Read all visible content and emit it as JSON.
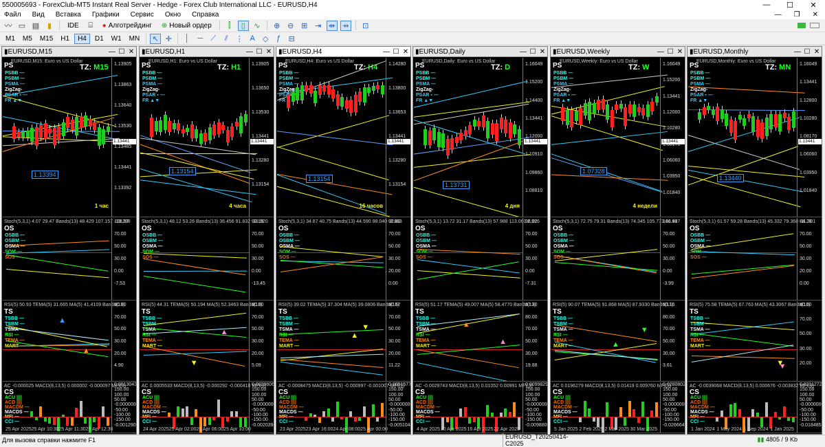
{
  "window": {
    "title": "550005693 - ForexClub-MT5 Instant Real Server - Hedge - Forex Club International LLC - EURUSD,H4",
    "min_icon": "minimize-icon",
    "max_icon": "maximize-icon",
    "close_icon": "close-icon"
  },
  "menu": {
    "items": [
      "Файл",
      "Вид",
      "Вставка",
      "Графики",
      "Сервис",
      "Окно",
      "Справка"
    ]
  },
  "toolbar": {
    "ide": "IDE",
    "algo": "Алготрейдинг",
    "new_order": "Новый ордер"
  },
  "timeframes": {
    "items": [
      "M1",
      "M5",
      "M15",
      "H1",
      "H4",
      "D1",
      "W1",
      "MN"
    ],
    "active": "H4"
  },
  "charts": [
    {
      "tab": "EURUSD,M15",
      "desc": "EURUSD,M15: Euro vs US Dollar",
      "tz": "M15",
      "period": "1 час",
      "prices": [
        "1.13905",
        "1.13863",
        "1.13640",
        "1.13530",
        "1.13485",
        "1.13441",
        "1.13392"
      ],
      "box": "1.13394",
      "os_hdr": "Stoch(5,3,1) 4.07 29.47 Bands(13) 48.429 107.157 -10.298",
      "os_axis": [
        "108.97",
        "70.00",
        "50.00",
        "30.00",
        "0.00",
        "-7.53"
      ],
      "ts_hdr": "RSI(5) 50.93 TEMA(5) 31.665 MA(5) 41.4109 Bands(13)",
      "ts_axis": [
        "80.00",
        "70.00",
        "50.00",
        "30.00",
        "20.00",
        "4.90"
      ],
      "cs_hdr": "AC -0.000025 MACD(8,13,5) 0.000002 -0.000097 MFI(3)",
      "cs_axis": [
        "0.0013043",
        "150.00",
        "100.00",
        "50.00",
        "-0.0000000",
        "-50.00",
        "-100.00",
        "-150.00",
        "-0.0012909"
      ],
      "dates": [
        "25 Apr 2025",
        "25 Apr 10:30",
        "25 Apr 11:30",
        "25 Apr 12:30"
      ]
    },
    {
      "tab": "EURUSD,H1",
      "desc": "EURUSD,H1: Euro vs US Dollar",
      "tz": "H1",
      "period": "4 часа",
      "prices": [
        "1.13905",
        "1.13650",
        "1.13530",
        "1.13441",
        "1.13280",
        "1.13154"
      ],
      "box": "1.13154",
      "os_hdr": "Stoch(5,3,1) 48.12 53.26 Bands(13) 36.456 91.832 -18.920",
      "os_axis": [
        "92.15",
        "70.00",
        "50.00",
        "30.00",
        "0.00",
        "-13.45"
      ],
      "ts_hdr": "RSI(5) 44.31 TEMA(5) 50.194 MA(5) 52.3463 Bands(13)",
      "ts_axis": [
        "80.00",
        "70.00",
        "50.00",
        "30.00",
        "20.00",
        "5.09"
      ],
      "cs_hdr": "AC 0.0005533 MACD(8,13,5) -0.000292 -0.000418 MFI(3)",
      "cs_axis": [
        "0.0020606",
        "150.00",
        "100.00",
        "50.00",
        "-0.0000000",
        "-50.00",
        "-100.00",
        "-150.00",
        "-0.0020394"
      ],
      "dates": [
        "24 Apr 2025",
        "25 Apr 02:00",
        "25 Apr 06:00",
        "25 Apr 10:00"
      ]
    },
    {
      "tab": "EURUSD,H4",
      "desc": "EURUSD,H4: Euro vs US Dollar",
      "tz": "H4",
      "period": "16 часов",
      "prices": [
        "1.14280",
        "1.13800",
        "1.13653",
        "1.13441",
        "1.13280",
        "1.13154"
      ],
      "box": "1.13154",
      "os_hdr": "Stoch(5,3,1) 34.87 40.75 Bands(13) 44.590 98.040 -8.863",
      "os_axis": [
        "92.80",
        "70.00",
        "50.00",
        "30.00",
        "20.00",
        "0.00"
      ],
      "ts_hdr": "RSI(5) 39.02 TEMA(5) 37.304 MA(5) 39.0806 Bands(13)",
      "ts_axis": [
        "80.67",
        "70.00",
        "50.00",
        "30.00",
        "20.00",
        "11.22"
      ],
      "cs_hdr": "AC -0.0008475 MACD(8,13,5) -0.000997 -0.001007 MFI(3)",
      "cs_axis": [
        "0.0051577",
        "150.00",
        "100.00",
        "50.00",
        "-0.0000000",
        "-50.00",
        "-100.00",
        "-150.00",
        "-0.0051046"
      ],
      "dates": [
        "23 Apr 2025",
        "23 Apr 16:00",
        "24 Apr 08:00",
        "25 Apr 00:00"
      ]
    },
    {
      "tab": "EURUSD,Daily",
      "desc": "EURUSD,Daily: Euro vs US Dollar",
      "tz": "D",
      "period": "4 дня",
      "prices": [
        "1.16049",
        "1.15200",
        "1.14400",
        "1.13441",
        "1.12000",
        "1.10910",
        "1.09860",
        "1.08810"
      ],
      "box": "1.13731",
      "os_hdr": "Stoch(5,3,1) 13.72 31.17 Bands(13) 57.988 113.060 2.916",
      "os_axis": [
        "96.02",
        "70.00",
        "50.00",
        "30.00",
        "0.00",
        "-7.31"
      ],
      "ts_hdr": "RSI(5) 51.17 TEMA(5) 49.007 MA(5) 58.4770 Bands(13)",
      "ts_axis": [
        "87.30",
        "80.00",
        "70.00",
        "50.00",
        "30.00",
        "19.88"
      ],
      "cs_hdr": "AC -0.0029743 MACD(8,13,5) 0.01052 0.00991 MFI(3)",
      "cs_axis": [
        "0.0099829",
        "150.00",
        "100.00",
        "50.00",
        "-0.0000000",
        "-50.00",
        "-100.00",
        "-150.00",
        "-0.0098800"
      ],
      "dates": [
        "4 Apr 2025",
        "10 Apr 2025",
        "16 Apr 2025",
        "22 Apr 2025"
      ]
    },
    {
      "tab": "EURUSD,Weekly",
      "desc": "EURUSD,Weekly: Euro vs US Dollar",
      "tz": "W",
      "period": "4 недели",
      "prices": [
        "1.16049",
        "1.15200",
        "1.13441",
        "1.12000",
        "1.10280",
        "1.08170",
        "1.06060",
        "1.03950",
        "1.01840"
      ],
      "box": "1.07328",
      "os_hdr": "Stoch(5,3,1) 72.75 79.31 Bands(13) 74.345 105.773 42.917",
      "os_axis": [
        "106.48",
        "70.00",
        "50.00",
        "30.00",
        "0.00",
        "-3.99"
      ],
      "ts_hdr": "RSI(5) 90.07 TEMA(5) 91.868 MA(5) 87.9330 Bands(13)",
      "ts_axis": [
        "93.16",
        "80.00",
        "70.00",
        "50.00",
        "30.00",
        "3.61"
      ],
      "cs_hdr": "AC 0.0196279 MACD(8,13,5) 0.01419 0.009760 MFI(3)",
      "cs_axis": [
        "0.0280802",
        "150.00",
        "100.00",
        "50.00",
        "-0.0000000",
        "-50.00",
        "-100.00",
        "-150.00",
        "-0.0266649"
      ],
      "dates": [
        "5 Jan 2025",
        "2 Feb 2025",
        "2 Mar 2025",
        "30 Mar 2025"
      ]
    },
    {
      "tab": "EURUSD,Monthly",
      "desc": "EURUSD,Monthly: Euro vs US Dollar",
      "tz": "MN",
      "period": "",
      "prices": [
        "1.16049",
        "1.13441",
        "1.12800",
        "1.10280",
        "1.08170",
        "1.06060",
        "1.03950",
        "1.01840"
      ],
      "box": "1.13440",
      "os_hdr": "Stoch(5,3,1) 61.57 59.28 Bands(13) 45.332 79.368 -11.701",
      "os_axis": [
        "84.28",
        "70.00",
        "50.00",
        "30.00",
        "20.00",
        "0.00"
      ],
      "ts_hdr": "RSI(5) 75.58 TEMA(5) 67.763 MA(5) 43.3067 Bands(13)",
      "ts_axis": [
        "80.00",
        "70.00",
        "50.00",
        "30.00",
        "20.00"
      ],
      "cs_hdr": "AC -0.0039068 MACD(8,13,5) 0.000676 -0.003832 MFI(3)",
      "cs_axis": [
        "0.0211272",
        "150.00",
        "100.00",
        "50.00",
        "-0.0000000",
        "-50.00",
        "-100.00",
        "-150.00",
        "-0.0184853"
      ],
      "dates": [
        "1 Jan 2024",
        "1 May 2024",
        "1 Sep 2024",
        "1 Jan 2025"
      ]
    }
  ],
  "legends": {
    "ps": {
      "label": "PS",
      "items": [
        "PSBB —",
        "PSBM —",
        "PSMA —",
        "ZigZag-",
        "PSAR ▪ —",
        "FR ▲▼"
      ]
    },
    "os": {
      "label": "OS",
      "items": [
        "OSBB —",
        "OSBM —",
        "OSMA —",
        "SOM —",
        "SOS —"
      ]
    },
    "ts": {
      "label": "TS",
      "items": [
        "TSBB —",
        "TSBM —",
        "TSMA —",
        "RSI —",
        "TEMA —",
        "MART —"
      ]
    },
    "cs": {
      "label": "CS",
      "items": [
        "ACU ||||",
        "ACD ||||",
        "MACDM —",
        "MACDS —",
        "MFI —",
        "CCI —"
      ]
    },
    "tz_prefix": "TZ:"
  },
  "status": {
    "help": "Для вызова справки нажмите F1",
    "profile": "EURUSD_T20250414-C2025",
    "traffic": "4805 / 9 Kb"
  },
  "colors": {
    "up_candle": "#22cc22",
    "down_candle": "#ff2020",
    "yellow": "#f4f41c",
    "cyan": "#33ccff",
    "orange": "#ff8c1a",
    "red_level": "#cc2222"
  }
}
